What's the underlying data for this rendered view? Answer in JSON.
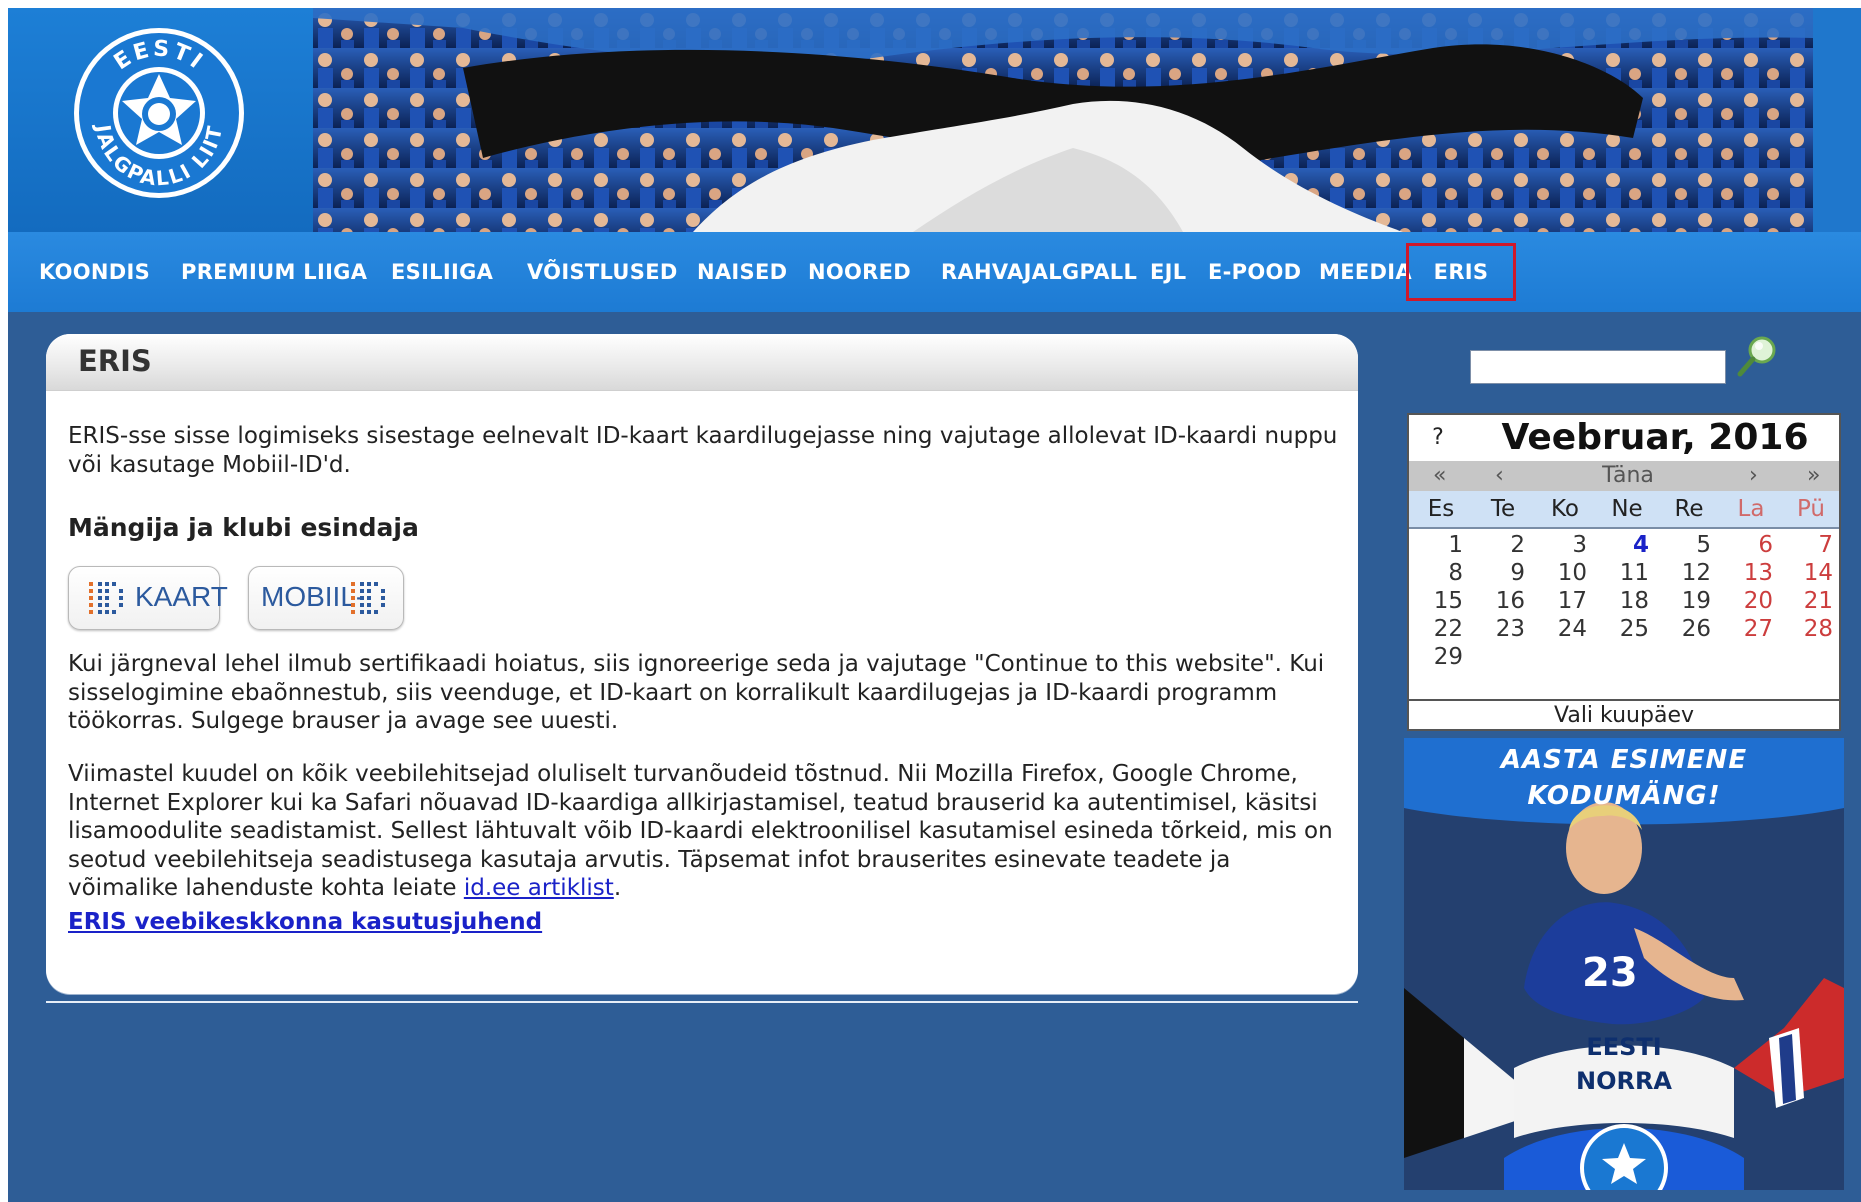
{
  "nav": {
    "items": [
      {
        "label": "KOONDIS"
      },
      {
        "label": "PREMIUM LIIGA"
      },
      {
        "label": "ESILIIGA"
      },
      {
        "label": "VÕISTLUSED"
      },
      {
        "label": "NAISED"
      },
      {
        "label": "NOORED"
      },
      {
        "label": "RAHVAJALGPALL"
      },
      {
        "label": "EJL"
      },
      {
        "label": "E-POOD"
      },
      {
        "label": "MEEDIA"
      },
      {
        "label": "ERIS",
        "active": true
      }
    ]
  },
  "logo": {
    "text_top": "EESTI",
    "text_bottom": "JALGPALLI LIIT"
  },
  "main": {
    "title": "ERIS",
    "intro": "ERIS-sse sisse logimiseks sisestage eelnevalt ID-kaart kaardilugejasse ning vajutage allolevat ID-kaardi nuppu või kasutage Mobiil-ID'd.",
    "subheading": "Mängija ja klubi esindaja",
    "id_card_button": {
      "label": "KAART"
    },
    "mobile_id_button": {
      "label": "MOBIIL-"
    },
    "warning": "Kui järgneval lehel ilmub sertifikaadi hoiatus, siis ignoreerige seda ja vajutage \"Continue to this website\". Kui sisselogimine ebaõnnestub, siis veenduge, et ID-kaart on korralikult kaardilugejas ja ID-kaardi programm töökorras. Sulgege brauser ja avage see uuesti.",
    "browser_note": "Viimastel kuudel on kõik veebilehitsejad oluliselt turvanõudeid tõstnud. Nii Mozilla Firefox, Google Chrome, Internet Explorer kui ka Safari nõuavad ID-kaardiga allkirjastamisel, teatud brauserid ka autentimisel, käsitsi lisamoodulite seadistamist. Sellest lähtuvalt võib ID-kaardi elektroonilisel kasutamisel esineda tõrkeid, mis on seotud veebilehitseja seadistusega kasutaja arvutis. Täpsemat infot brauserites esinevate teadete ja võimalike lahenduste kohta leiate",
    "browser_note_link": "id.ee artiklist",
    "browser_note_end": ".",
    "guide_link": "ERIS veebikeskkonna kasutusjuhend"
  },
  "search": {
    "value": "",
    "placeholder": ""
  },
  "calendar": {
    "help": "?",
    "title": "Veebruar, 2016",
    "nav": {
      "prev_year": "«",
      "prev_month": "‹",
      "today": "Täna",
      "next_month": "›",
      "next_year": "»"
    },
    "weekdays": [
      "Es",
      "Te",
      "Ko",
      "Ne",
      "Re",
      "La",
      "Pü"
    ],
    "weeks": [
      [
        "1",
        "2",
        "3",
        "4",
        "5",
        "6",
        "7"
      ],
      [
        "8",
        "9",
        "10",
        "11",
        "12",
        "13",
        "14"
      ],
      [
        "15",
        "16",
        "17",
        "18",
        "19",
        "20",
        "21"
      ],
      [
        "22",
        "23",
        "24",
        "25",
        "26",
        "27",
        "28"
      ],
      [
        "29",
        "",
        "",
        "",
        "",
        "",
        ""
      ]
    ],
    "today_day": "4",
    "footer": "Vali kuupäev"
  },
  "ad": {
    "headline_1": "AASTA ESIMENE",
    "headline_2": "KODUMÄNG!",
    "team_1": "EESTI",
    "team_2": "NORRA",
    "shirt_number": "23"
  },
  "colors": {
    "page_bg": "#2e5d96",
    "nav_bg": "#1d7bd4",
    "active_outline": "#d0182a",
    "link": "#1a22c8",
    "weekend": "#cc3d3d"
  }
}
